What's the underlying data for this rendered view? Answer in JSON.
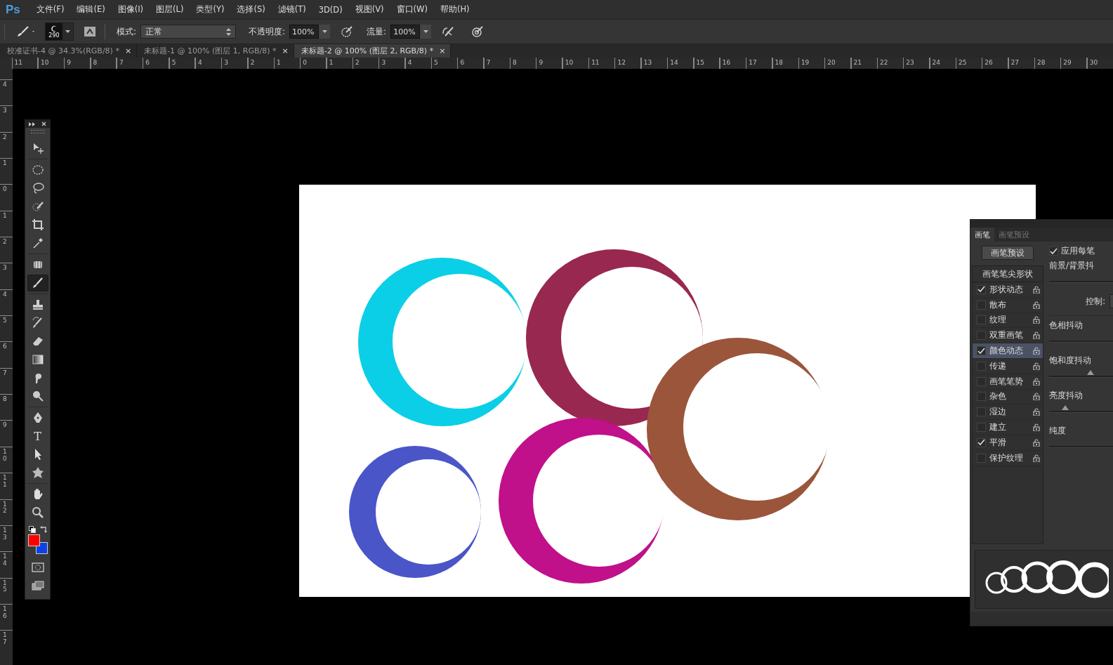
{
  "menu": {
    "logo": "Ps",
    "items": [
      "文件(F)",
      "编辑(E)",
      "图像(I)",
      "图层(L)",
      "类型(Y)",
      "选择(S)",
      "滤镜(T)",
      "3D(D)",
      "视图(V)",
      "窗口(W)",
      "帮助(H)"
    ]
  },
  "options": {
    "brush_size": "290",
    "mode_label": "模式:",
    "mode_value": "正常",
    "opacity_label": "不透明度:",
    "opacity_value": "100%",
    "flow_label": "流量:",
    "flow_value": "100%"
  },
  "tabs": [
    {
      "label": "校准证书-4 @ 34.3%(RGB/8) *",
      "close": "×",
      "selected": false
    },
    {
      "label": "未标题-1 @ 100% (图层 1, RGB/8) *",
      "close": "×",
      "selected": false
    },
    {
      "label": "未标题-2 @ 100% (图层 2, RGB/8) *",
      "close": "×",
      "selected": true
    }
  ],
  "rulers": {
    "horizontal": [
      "11",
      "10",
      "9",
      "8",
      "7",
      "6",
      "5",
      "4",
      "3",
      "2",
      "1",
      "0",
      "1",
      "2",
      "3",
      "4",
      "5",
      "6",
      "7",
      "8",
      "9",
      "10",
      "11",
      "12",
      "13",
      "14",
      "15",
      "16",
      "17",
      "18",
      "19",
      "20",
      "21",
      "22",
      "23",
      "24",
      "25",
      "26",
      "27",
      "28",
      "29",
      "30"
    ],
    "vertical": [
      "4",
      "3",
      "2",
      "1",
      "0",
      "1",
      "2",
      "3",
      "4",
      "5",
      "6",
      "7",
      "8",
      "9",
      "10",
      "11",
      "12",
      "13",
      "14",
      "15",
      "16",
      "17"
    ]
  },
  "toolbar": {
    "tools": [
      {
        "kind": "move",
        "selected": false
      },
      {
        "kind": "marquee",
        "selected": false
      },
      {
        "kind": "lasso",
        "selected": false
      },
      {
        "kind": "quick",
        "selected": false
      },
      {
        "kind": "crop",
        "selected": false
      },
      {
        "kind": "eyedropper",
        "selected": false
      },
      {
        "kind": "patch",
        "selected": false
      },
      {
        "kind": "brush",
        "selected": true
      },
      {
        "kind": "stamp",
        "selected": false
      },
      {
        "kind": "history",
        "selected": false
      },
      {
        "kind": "eraser",
        "selected": false
      },
      {
        "kind": "gradient",
        "selected": false
      },
      {
        "kind": "smudge",
        "selected": false
      },
      {
        "kind": "dodge",
        "selected": false
      },
      {
        "kind": "pen",
        "selected": false
      },
      {
        "kind": "type",
        "label": "T",
        "selected": false
      },
      {
        "kind": "select",
        "selected": false
      },
      {
        "kind": "shape",
        "selected": false
      },
      {
        "kind": "hand",
        "selected": false
      },
      {
        "kind": "zoom",
        "selected": false
      }
    ]
  },
  "canvas": {
    "strokes": [
      {
        "color": "#0bcfe6"
      },
      {
        "color": "#98284f"
      },
      {
        "color": "#4a55c8"
      },
      {
        "color": "#c0108a"
      },
      {
        "color": "#9a553a"
      }
    ]
  },
  "brush_panel": {
    "tabs": [
      {
        "label": "画笔",
        "selected": true
      },
      {
        "label": "画笔预设",
        "selected": false
      }
    ],
    "preset_button": "画笔预设",
    "tip_shape": "画笔笔尖形状",
    "options": [
      {
        "label": "形状动态",
        "checked": true,
        "selected": false
      },
      {
        "label": "散布",
        "checked": false,
        "selected": false
      },
      {
        "label": "纹理",
        "checked": false,
        "selected": false
      },
      {
        "label": "双重画笔",
        "checked": false,
        "selected": false
      },
      {
        "label": "颜色动态",
        "checked": true,
        "selected": true
      },
      {
        "label": "传递",
        "checked": false,
        "selected": false
      },
      {
        "label": "画笔笔势",
        "checked": false,
        "selected": false
      },
      {
        "label": "杂色",
        "checked": false,
        "selected": false
      },
      {
        "label": "湿边",
        "checked": false,
        "selected": false
      },
      {
        "label": "建立",
        "checked": false,
        "selected": false
      },
      {
        "label": "平滑",
        "checked": true,
        "selected": false
      },
      {
        "label": "保护纹理",
        "checked": false,
        "selected": false
      }
    ],
    "apply_per_tip": {
      "label": "应用每笔",
      "checked": true
    },
    "settings": [
      {
        "kind": "jitter",
        "label": "前景/背景抖"
      },
      {
        "kind": "control",
        "label": "控制:"
      },
      {
        "kind": "jitter",
        "label": "色相抖动"
      },
      {
        "kind": "jitter",
        "label": "饱和度抖动",
        "level": 0.6
      },
      {
        "kind": "jitter",
        "label": "亮度抖动",
        "level": 0.23
      },
      {
        "kind": "jitter",
        "label": "纯度"
      }
    ]
  }
}
